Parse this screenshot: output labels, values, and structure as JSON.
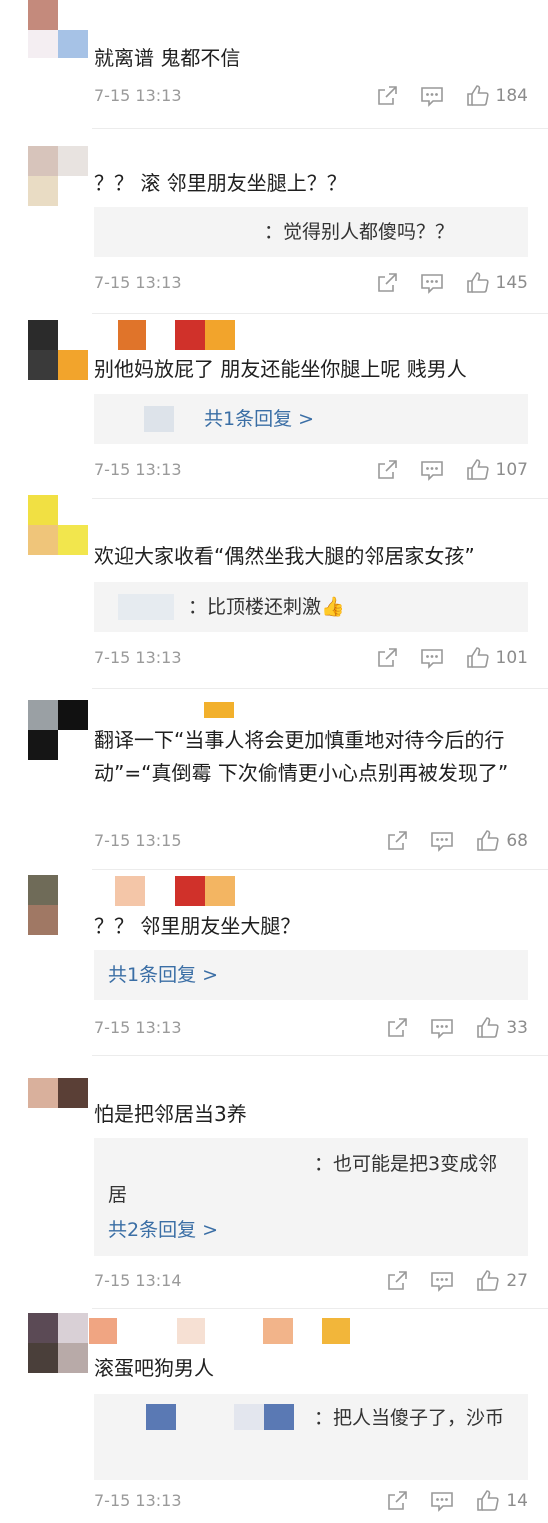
{
  "comments": [
    {
      "avatar_colors": [
        "#c48a7c",
        "#ffffff",
        "#f4eef2",
        "#a6c2e6"
      ],
      "name_colors": [],
      "text": "就离谱 鬼都不信",
      "quote": null,
      "time": "7-15 13:13",
      "likes": "184"
    },
    {
      "avatar_colors": [
        "#d7c4bb",
        "#e8e3e0",
        "#e9dcc4",
        "#ffffff"
      ],
      "name_colors": [],
      "text": "？？ 滚 邻里朋友坐腿上？？",
      "quote": {
        "text": "：觉得别人都傻吗？？",
        "reply_link": ""
      },
      "time": "7-15 13:13",
      "likes": "145"
    },
    {
      "avatar_colors": [
        "#2b2b2b",
        "#ffffff",
        "#3a3a3a",
        "#f2a42c"
      ],
      "name_colors": [
        "#e0742a",
        "#d0312a",
        "#f2a42c"
      ],
      "text": "别他妈放屁了  朋友还能坐你腿上呢 贱男人",
      "quote": {
        "text": "",
        "reply_link": "共1条回复 >"
      },
      "time": "7-15 13:13",
      "likes": "107"
    },
    {
      "avatar_colors": [
        "#f1e043",
        "#ffffff",
        "#efc57a",
        "#f2e64d"
      ],
      "name_colors": [],
      "text": "欢迎大家收看“偶然坐我大腿的邻居家女孩”",
      "quote": {
        "text": "：比顶楼还刺激👍",
        "reply_link": ""
      },
      "time": "7-15 13:13",
      "likes": "101"
    },
    {
      "avatar_colors": [
        "#9aa0a4",
        "#111111",
        "#151515",
        "#ffffff"
      ],
      "name_colors": [
        "#f2b02c"
      ],
      "text": "翻译一下“当事人将会更加慎重地对待今后的行动”=“真倒霉 下次偷情更小心点别再被发现了”",
      "quote": null,
      "time": "7-15 13:15",
      "likes": "68"
    },
    {
      "avatar_colors": [
        "#6f6b58",
        "#ffffff",
        "#a07864",
        "#ffffff"
      ],
      "name_colors": [
        "#f4c6a8",
        "#d0312a",
        "#f3b562"
      ],
      "text": "？？ 邻里朋友坐大腿？",
      "quote": {
        "text": "",
        "reply_link": "共1条回复 >"
      },
      "time": "7-15 13:13",
      "likes": "33"
    },
    {
      "avatar_colors": [
        "#d9b09c",
        "#5a3f36",
        "#ffffff",
        "#ffffff"
      ],
      "name_colors": [],
      "text": "怕是把邻居当3养",
      "quote": {
        "text": "：也可能是把3变成邻居",
        "reply_link": "共2条回复 >"
      },
      "time": "7-15 13:14",
      "likes": "27"
    },
    {
      "avatar_colors": [
        "#5b4a55",
        "#d9d0d6",
        "#4a3f3a",
        "#b8aaa8"
      ],
      "name_colors": [
        "#f0a582",
        "#f6e0d3",
        "#f2b48a",
        "#f2b63a"
      ],
      "text": "滚蛋吧狗男人",
      "quote": {
        "text": "：把人当傻子了，沙币",
        "reply_link": ""
      },
      "time": "7-15 13:13",
      "likes": "14"
    }
  ]
}
